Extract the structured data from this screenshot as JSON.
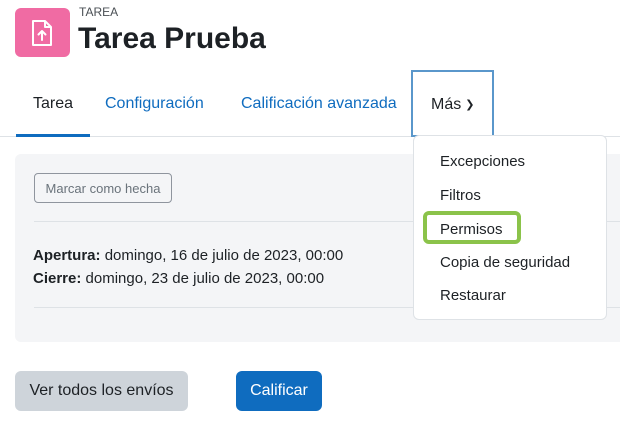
{
  "header": {
    "activity_type": "TAREA",
    "title": "Tarea Prueba",
    "icon": "assignment-upload-icon",
    "icon_color": "#f06ba3"
  },
  "tabs": [
    {
      "label": "Tarea",
      "active": true
    },
    {
      "label": "Configuración"
    },
    {
      "label": "Calificación avanzada"
    },
    {
      "label": "Más",
      "icon": "chevron-down-icon",
      "focused": true
    }
  ],
  "more_menu": {
    "items": [
      "Excepciones",
      "Filtros",
      "Permisos",
      "Copia de seguridad",
      "Restaurar"
    ],
    "highlighted": "Permisos",
    "highlight_color": "#8bc34a"
  },
  "card": {
    "mark_done_label": "Marcar como hecha",
    "opening_label": "Apertura:",
    "opening_value": "domingo, 16 de julio de 2023, 00:00",
    "closing_label": "Cierre:",
    "closing_value": "domingo, 23 de julio de 2023, 00:00"
  },
  "actions": {
    "view_all_label": "Ver todos los envíos",
    "grade_label": "Calificar",
    "primary_color": "#0f6cbf"
  }
}
